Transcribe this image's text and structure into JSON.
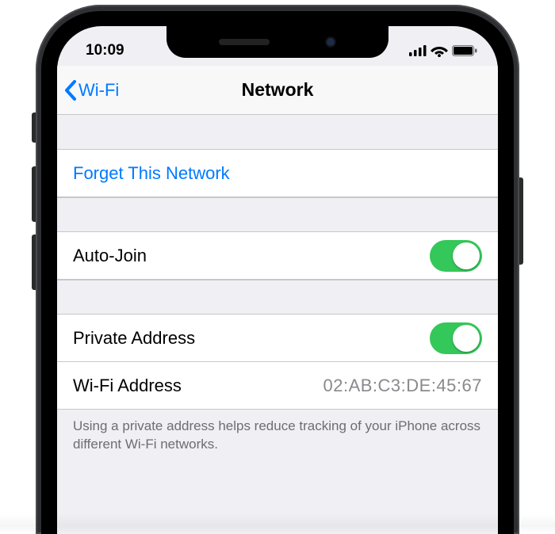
{
  "status": {
    "time": "10:09"
  },
  "nav": {
    "back_label": "Wi-Fi",
    "title": "Network"
  },
  "forget": {
    "label": "Forget This Network"
  },
  "auto_join": {
    "label": "Auto-Join",
    "on": true
  },
  "private_addr": {
    "label": "Private Address",
    "on": true
  },
  "wifi_addr": {
    "label": "Wi-Fi Address",
    "value": "02:AB:C3:DE:45:67"
  },
  "footer": {
    "text": "Using a private address helps reduce tracking of your iPhone across different Wi-Fi networks."
  }
}
